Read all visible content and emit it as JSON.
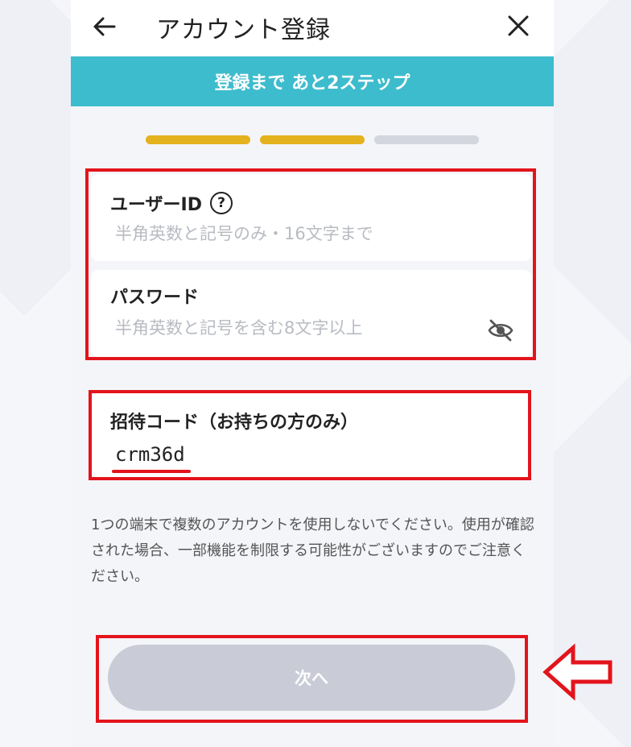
{
  "header": {
    "title": "アカウント登録",
    "back_icon": "arrow-left",
    "close_icon": "close-x"
  },
  "banner": {
    "text": "登録まで あと2ステップ",
    "color": "#3dbccd"
  },
  "progress": {
    "steps_total": 3,
    "steps_done": 2,
    "done_color": "#e4b21e",
    "todo_color": "#d4d6df"
  },
  "form": {
    "user_id": {
      "label": "ユーザーID",
      "help_icon": "question-circle",
      "help_glyph": "?",
      "placeholder": "半角英数と記号のみ・16文字まで"
    },
    "password": {
      "label": "パスワード",
      "placeholder": "半角英数と記号を含む8文字以上",
      "visibility_icon": "eye-slash"
    },
    "invite_code": {
      "label": "招待コード（お持ちの方のみ）",
      "value": "crm36d"
    }
  },
  "notice": "1つの端末で複数のアカウントを使用しないでください。使用が確認された場合、一部機能を制限する可能性がございますのでご注意ください。",
  "buttons": {
    "next": "次へ",
    "next_enabled": false
  },
  "annotation": {
    "highlight_color": "#e3141c",
    "pointer_icon": "arrow-left-outline"
  }
}
